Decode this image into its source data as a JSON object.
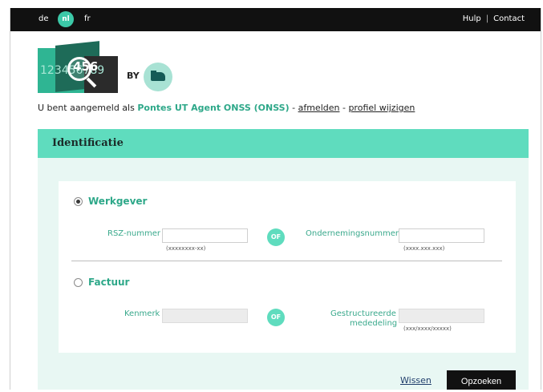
{
  "languages": {
    "de": "de",
    "nl": "nl",
    "fr": "fr",
    "active": "nl"
  },
  "toplinks": {
    "help": "Hulp",
    "separator": "|",
    "contact": "Contact"
  },
  "logo": {
    "numbers": "123456789",
    "highlight": "456",
    "by": "BY"
  },
  "status": {
    "prefix": "U bent aangemeld als",
    "user": "Pontes UT Agent ONSS (ONSS)",
    "sep1": "-",
    "logout": "afmelden",
    "sep2": "-",
    "profile": "profiel wijzigen"
  },
  "panel": {
    "title": "Identificatie"
  },
  "werkgever": {
    "label": "Werkgever",
    "selected": true,
    "rsz_label": "RSZ-nummer",
    "rsz_value": "",
    "rsz_hint": "(xxxxxxxx-xx)",
    "of": "OF",
    "onderneming_label": "Ondernemingsnummer",
    "onderneming_value": "",
    "onderneming_hint": "(xxxx.xxx.xxx)"
  },
  "factuur": {
    "label": "Factuur",
    "selected": false,
    "kenmerk_label": "Kenmerk",
    "kenmerk_value": "",
    "of": "OF",
    "gestr_label_1": "Gestructureerde",
    "gestr_label_2": "mededeling",
    "gestr_value": "",
    "gestr_hint": "(xxx/xxxx/xxxxx)"
  },
  "actions": {
    "clear": "Wissen",
    "search": "Opzoeken"
  },
  "colors": {
    "accent": "#5fdcbe",
    "accent_text": "#2ea889",
    "topbar": "#111111",
    "panel_bg": "#e8f7f3"
  }
}
